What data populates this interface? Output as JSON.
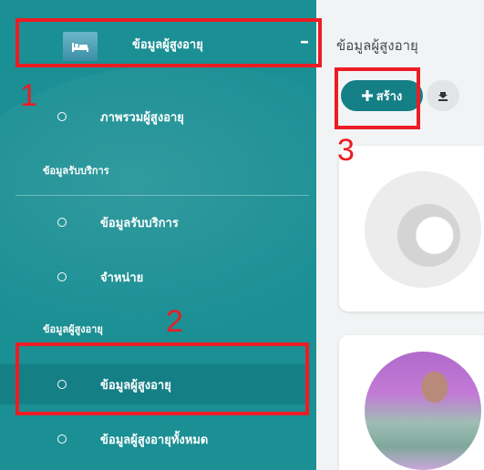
{
  "sidebar": {
    "header": {
      "label": "ข้อมูลผู้สูงอายุ",
      "collapse_symbol": "–"
    },
    "overview_item": {
      "label": "ภาพรวมผู้สูงอายุ"
    },
    "section_services": {
      "label": "ข้อมูลรับบริการ"
    },
    "services_items": [
      {
        "label": "ข้อมูลรับบริการ"
      },
      {
        "label": "จำหน่าย"
      }
    ],
    "section_elderly": {
      "label": "ข้อมูลผู้สูงอายุ"
    },
    "elderly_items": [
      {
        "label": "ข้อมูลผู้สูงอายุ",
        "active": true
      },
      {
        "label": "ข้อมูลผู้สูงอายุทั้งหมด"
      }
    ]
  },
  "main": {
    "page_title": "ข้อมูลผู้สูงอายุ",
    "create_button": {
      "icon": "plus-icon",
      "label": "สร้าง"
    },
    "download_button": {
      "icon": "download-icon"
    }
  },
  "annotations": [
    {
      "number": "1"
    },
    {
      "number": "2"
    },
    {
      "number": "3"
    }
  ],
  "colors": {
    "sidebar_bg": "#1a8f94",
    "accent": "#157f86",
    "annotation_red": "#ec1c24"
  }
}
